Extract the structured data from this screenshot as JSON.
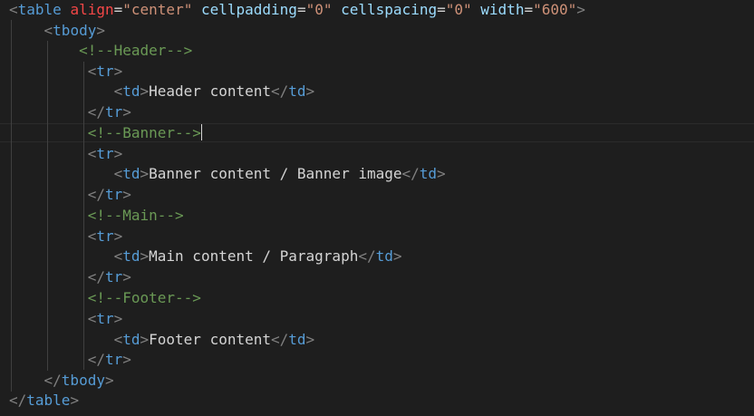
{
  "editor": {
    "line1": {
      "tag": "table",
      "attr1": "align",
      "val1": "\"center\"",
      "attr2": "cellpadding",
      "val2": "\"0\"",
      "attr3": "cellspacing",
      "val3": "\"0\"",
      "attr4": "width",
      "val4": "\"600\""
    },
    "tbody_open": "tbody",
    "comment_header": "<!--Header-->",
    "comment_banner": "<!--Banner-->",
    "comment_main": "<!--Main-->",
    "comment_footer": "<!--Footer-->",
    "tr": "tr",
    "td": "td",
    "header_content": "Header content",
    "banner_content": "Banner content / Banner image",
    "main_content": "Main content / Paragraph",
    "footer_content": "Footer content",
    "tbody_close": "tbody",
    "table_close": "table"
  },
  "colors": {
    "background": "#1e1e1e",
    "tag": "#569cd6",
    "bracket": "#808080",
    "attribute": "#9cdcfe",
    "attribute_highlight": "#f44747",
    "string": "#ce9178",
    "comment": "#6a9955",
    "text": "#d4d4d4"
  }
}
